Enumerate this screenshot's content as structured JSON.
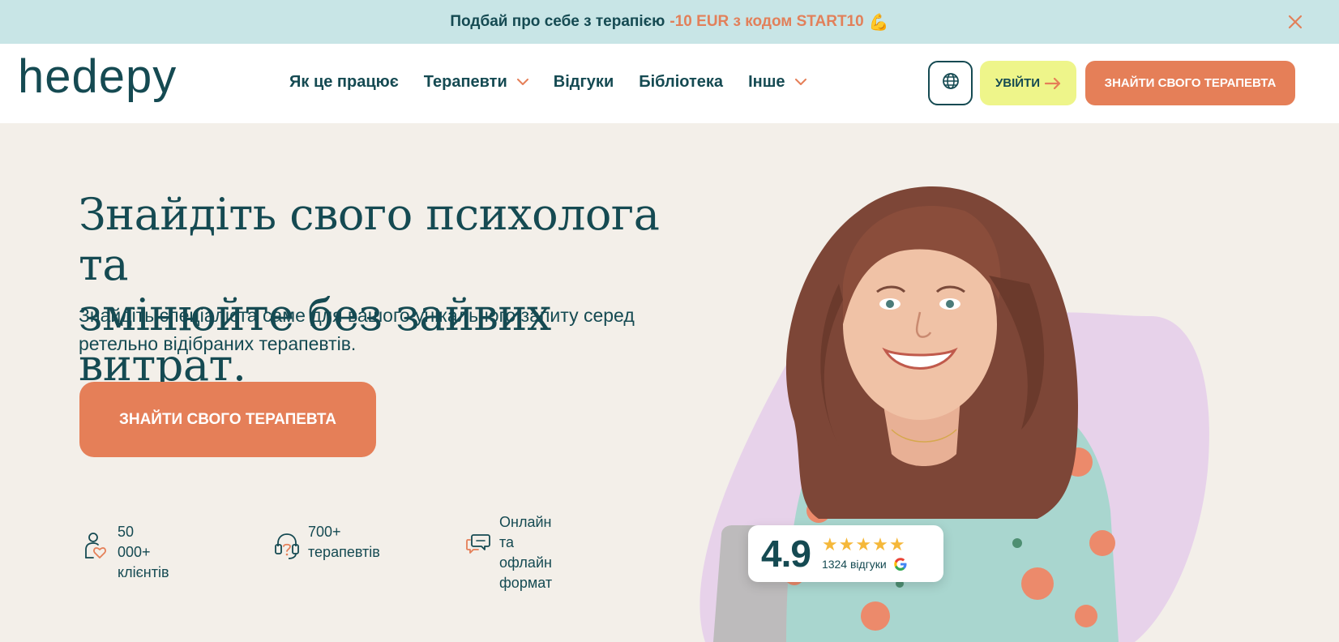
{
  "promo": {
    "text": "Подбай про себе з терапією",
    "discount": "-10 EUR з кодом START10",
    "emoji": "💪"
  },
  "header": {
    "logo": "hedepy",
    "nav": [
      {
        "label": "Як це працює",
        "dropdown": false
      },
      {
        "label": "Терапевти",
        "dropdown": true
      },
      {
        "label": "Відгуки",
        "dropdown": false
      },
      {
        "label": "Бібліотека",
        "dropdown": false
      },
      {
        "label": "Інше",
        "dropdown": true
      }
    ],
    "login_label": "УВІЙТИ",
    "cta_label": "ЗНАЙТИ СВОГО ТЕРАПЕВТА"
  },
  "hero": {
    "title_line1": "Знайдіть свого психолога та",
    "title_line2": "змінюйте без зайвих витрат.",
    "subtitle_line1": "Знайдіть спеціаліста саме для вашого унікального запиту серед",
    "subtitle_line2": "ретельно відібраних терапевтів.",
    "cta_label": "ЗНАЙТИ СВОГО ТЕРАПЕВТА"
  },
  "stats": [
    {
      "icon": "client-heart-icon",
      "line1": "50 000+",
      "line2": "клієнтів"
    },
    {
      "icon": "headset-icon",
      "line1": "700+",
      "line2": "терапевтів"
    },
    {
      "icon": "chat-bubbles-icon",
      "line1": "Онлайн та",
      "line2": "офлайн",
      "line3": "формат"
    }
  ],
  "rating": {
    "score": "4.9",
    "stars": "★★★★★",
    "count": "1324 відгуки"
  },
  "colors": {
    "primary": "#154a52",
    "accent": "#e57f58",
    "promo_bg": "#c8e5e6",
    "login_bg": "#eef58a",
    "page_bg": "#f3efe9",
    "blob": "#e7d2ea",
    "star": "#f5b83a"
  }
}
